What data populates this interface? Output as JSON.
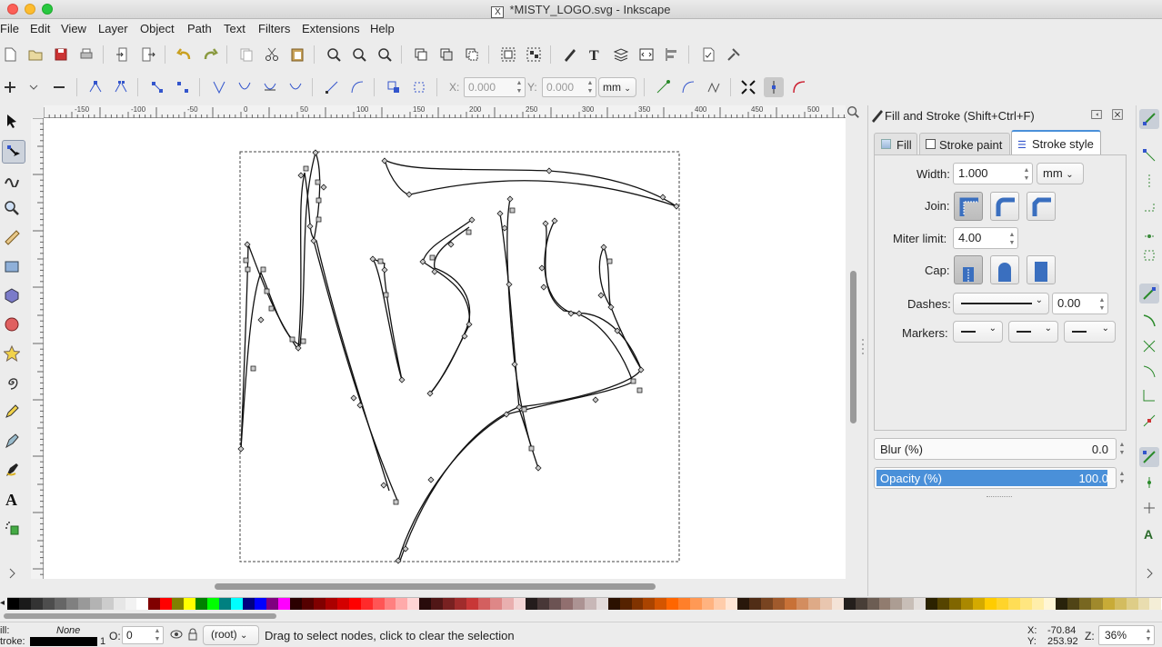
{
  "window": {
    "title": "*MISTY_LOGO.svg - Inkscape",
    "x_glyph": "X"
  },
  "menu": [
    "File",
    "Edit",
    "View",
    "Layer",
    "Object",
    "Path",
    "Text",
    "Filters",
    "Extensions",
    "Help"
  ],
  "node_toolbar": {
    "x_label": "X:",
    "x_value": "0.000",
    "y_label": "Y:",
    "y_value": "0.000",
    "unit": "mm"
  },
  "ruler": {
    "h_ticks": [
      "-150",
      "-100",
      "-50",
      "0",
      "50",
      "100",
      "150",
      "200",
      "250",
      "300",
      "350",
      "400",
      "450",
      "500"
    ]
  },
  "panel": {
    "title": "Fill and Stroke (Shift+Ctrl+F)",
    "tabs": [
      {
        "label": "Fill"
      },
      {
        "label": "Stroke paint"
      },
      {
        "label": "Stroke style"
      }
    ],
    "width_label": "Width:",
    "width_value": "1.000",
    "width_unit": "mm",
    "join_label": "Join:",
    "miter_label": "Miter limit:",
    "miter_value": "4.00",
    "cap_label": "Cap:",
    "dashes_label": "Dashes:",
    "dash_offset": "0.00",
    "markers_label": "Markers:",
    "blur_label": "Blur (%)",
    "blur_value": "0.0",
    "opacity_label": "Opacity (%)",
    "opacity_value": "100.0",
    "opacity_level": 1.0
  },
  "status": {
    "fill_label": "ill:",
    "fill_value": "None",
    "stroke_label": "troke:",
    "stroke_width": "1",
    "opacity_label": "O:",
    "opacity_value": "0",
    "layer": "(root)",
    "message": "Drag to select nodes, click to clear the selection",
    "x_label": "X:",
    "x_value": "-70.84",
    "y_label": "Y:",
    "y_value": "253.92",
    "zoom_label": "Z:",
    "zoom_value": "36%"
  },
  "colors": {
    "accent": "#4a90d9",
    "selection_blue": "#3d7fe0"
  },
  "palette": [
    "#000000",
    "#1a1a1a",
    "#333333",
    "#4d4d4d",
    "#666666",
    "#808080",
    "#999999",
    "#b3b3b3",
    "#cccccc",
    "#e6e6e6",
    "#f2f2f2",
    "#ffffff",
    "#800000",
    "#ff0000",
    "#808000",
    "#ffff00",
    "#008000",
    "#00ff00",
    "#008080",
    "#00ffff",
    "#000080",
    "#0000ff",
    "#800080",
    "#ff00ff",
    "#2b0000",
    "#550000",
    "#800000",
    "#aa0000",
    "#d40000",
    "#ff0000",
    "#ff2a2a",
    "#ff5555",
    "#ff8080",
    "#ffaaaa",
    "#ffd5d5",
    "#280b0b",
    "#501616",
    "#782121",
    "#a02c2c",
    "#c83737",
    "#d35f5f",
    "#de8787",
    "#e9afaf",
    "#f4d7d7",
    "#241c1c",
    "#483737",
    "#6c5353",
    "#916f6f",
    "#ac9393",
    "#c8b7b7",
    "#e3dbdb",
    "#2b1100",
    "#552200",
    "#803300",
    "#aa4400",
    "#d45500",
    "#ff6600",
    "#ff7f2a",
    "#ff9955",
    "#ffb380",
    "#ffccaa",
    "#ffe6d5",
    "#28170b",
    "#502d16",
    "#784421",
    "#a05a2c",
    "#c87137",
    "#d38d5f",
    "#deaa87",
    "#e9c6af",
    "#f4e3d7",
    "#241f1c",
    "#483e37",
    "#6c5d53",
    "#917c6f",
    "#ac9d93",
    "#c8beb7",
    "#e3dedb",
    "#2b2200",
    "#554400",
    "#806600",
    "#aa8800",
    "#d4aa00",
    "#ffcc00",
    "#ffd42a",
    "#ffdd55",
    "#ffe680",
    "#ffeeaa",
    "#fff6d5",
    "#28220b",
    "#504416",
    "#786721",
    "#a0892c",
    "#c8ab37",
    "#d3bc5f",
    "#decd87",
    "#e9ddaf",
    "#f4eed7"
  ]
}
